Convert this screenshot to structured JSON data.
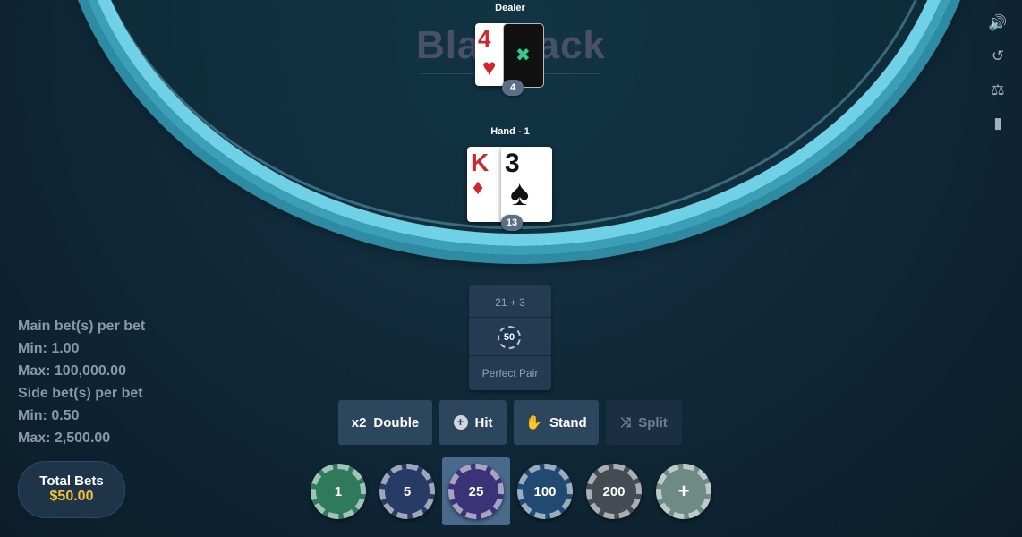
{
  "watermark": "Blackjack",
  "dealer": {
    "label": "Dealer",
    "card_rank": "4",
    "card_suit": "♥",
    "score": "4"
  },
  "hand": {
    "label": "Hand - 1",
    "cards": [
      {
        "rank": "K",
        "suit": "♦"
      },
      {
        "rank": "3",
        "suit": "♠"
      }
    ],
    "score": "13"
  },
  "side_icons": [
    "speaker-icon",
    "history-icon",
    "balance-scale-icon",
    "book-icon"
  ],
  "side_icon_glyphs": {
    "speaker": "🔊",
    "history": "↺",
    "scale": "⚖",
    "book": "▮"
  },
  "bet_box": {
    "top_label": "21 + 3",
    "chip_value": "50",
    "bottom_label": "Perfect Pair"
  },
  "limits": {
    "main_title": "Main bet(s) per bet",
    "main_min": "Min: 1.00",
    "main_max": "Max: 100,000.00",
    "side_title": "Side bet(s) per bet",
    "side_min": "Min: 0.50",
    "side_max": "Max: 2,500.00"
  },
  "total_bets": {
    "label": "Total Bets",
    "value": "$50.00"
  },
  "actions": {
    "double_icon": "x2",
    "double": "Double",
    "hit_icon": "+",
    "hit": "Hit",
    "stand_icon": "✋",
    "stand": "Stand",
    "split_icon": "⤨",
    "split": "Split"
  },
  "chips": [
    {
      "value": "1",
      "color": "#2f7a5c"
    },
    {
      "value": "5",
      "color": "#283a66"
    },
    {
      "value": "25",
      "color": "#3a3378"
    },
    {
      "value": "100",
      "color": "#214a72"
    },
    {
      "value": "200",
      "color": "#444b52"
    },
    {
      "value": "+",
      "color": "#6e8a84"
    }
  ],
  "selected_chip": "25"
}
